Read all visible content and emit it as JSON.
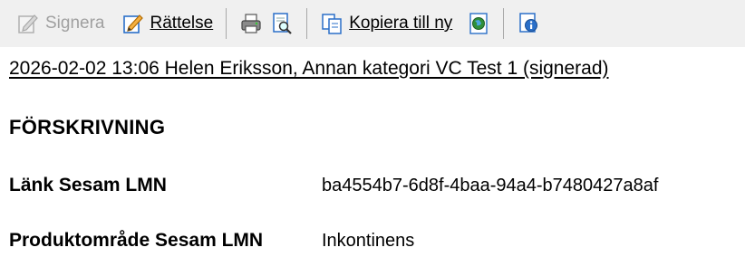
{
  "toolbar": {
    "sign_label": "Signera",
    "correct_label": "Rättelse",
    "copy_label": "Kopiera till ny",
    "icons": {
      "sign": "sign-icon",
      "correct": "pencil-icon",
      "print": "printer-icon",
      "preview": "print-preview-icon",
      "copy": "copy-icon",
      "web": "globe-icon",
      "info": "info-icon"
    }
  },
  "entry": {
    "header": "2026-02-02 13:06   Helen Eriksson, Annan kategori  VC Test 1   (signerad)",
    "section_title": "FÖRSKRIVNING",
    "fields": [
      {
        "label": "Länk Sesam LMN",
        "value": "ba4554b7-6d8f-4baa-94a4-b7480427a8af"
      },
      {
        "label": "Produktområde Sesam LMN",
        "value": "Inkontinens"
      }
    ]
  },
  "colors": {
    "toolbar_bg": "#f0f0f0",
    "disabled_text": "#a0a0a0",
    "accent_blue": "#1e6fd0",
    "accent_orange": "#f2a23c"
  }
}
